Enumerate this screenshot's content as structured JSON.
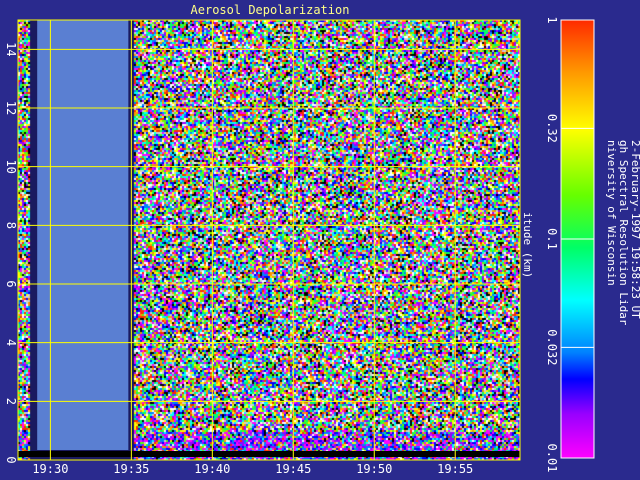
{
  "chart_data": {
    "type": "heatmap",
    "title": "Aerosol Depolarization",
    "ylabel": "itude (km)",
    "xlim": [
      "19:28",
      "19:59"
    ],
    "ylim": [
      0,
      15
    ],
    "x_ticks": [
      "19:30",
      "19:35",
      "19:40",
      "19:45",
      "19:50",
      "19:55"
    ],
    "y_ticks": [
      "0",
      "2",
      "4",
      "6",
      "8",
      "10",
      "12",
      "14"
    ],
    "grid": true,
    "no_data_interval": [
      "19:29",
      "19:35"
    ],
    "colorbar": {
      "scale": "log",
      "range": [
        0.01,
        1
      ],
      "ticks": [
        "1",
        "0.32",
        "0.1",
        "0.032",
        "0.01"
      ]
    },
    "annotation_lines": [
      "niversity of Wisconsin",
      "gh Spectral Resolution Lidar",
      "2-February-1997 19:58:23 UT"
    ]
  },
  "colors": {
    "background": "#2a2a8e",
    "grid": "#ffff00",
    "text": "#ffffff",
    "title": "#ffff88",
    "no_data": "#5a7fd2"
  }
}
